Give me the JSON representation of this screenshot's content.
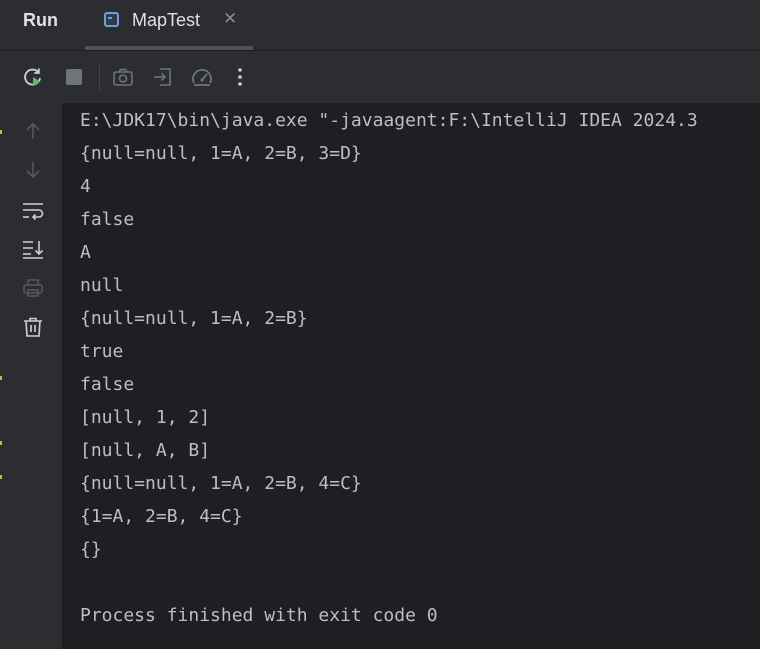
{
  "header": {
    "run_title": "Run",
    "tab": {
      "label": "MapTest",
      "close_glyph": "✕",
      "icon": "java-class-icon"
    }
  },
  "toolbar": {
    "icons": [
      "rerun-icon",
      "stop-icon",
      "screenshot-icon",
      "attach-icon",
      "profiler-icon",
      "more-icon"
    ]
  },
  "gutter": {
    "icons": [
      "arrow-up-icon",
      "arrow-down-icon",
      "soft-wrap-icon",
      "scroll-to-end-icon",
      "print-icon",
      "trash-icon"
    ]
  },
  "console": {
    "lines": [
      "E:\\JDK17\\bin\\java.exe \"-javaagent:F:\\IntelliJ IDEA 2024.3",
      "{null=null, 1=A, 2=B, 3=D}",
      "4",
      "false",
      "A",
      "null",
      "{null=null, 1=A, 2=B}",
      "true",
      "false",
      "[null, 1, 2]",
      "[null, A, B]",
      "{null=null, 1=A, 2=B, 4=C}",
      "{1=A, 2=B, 4=C}",
      "{}",
      "",
      "Process finished with exit code 0"
    ]
  },
  "colors": {
    "background": "#2b2d30",
    "console_background": "#1e1f22",
    "text": "#bcbec4",
    "rerun_green": "#5fb865",
    "tab_icon_blue": "#6f9fd8"
  }
}
